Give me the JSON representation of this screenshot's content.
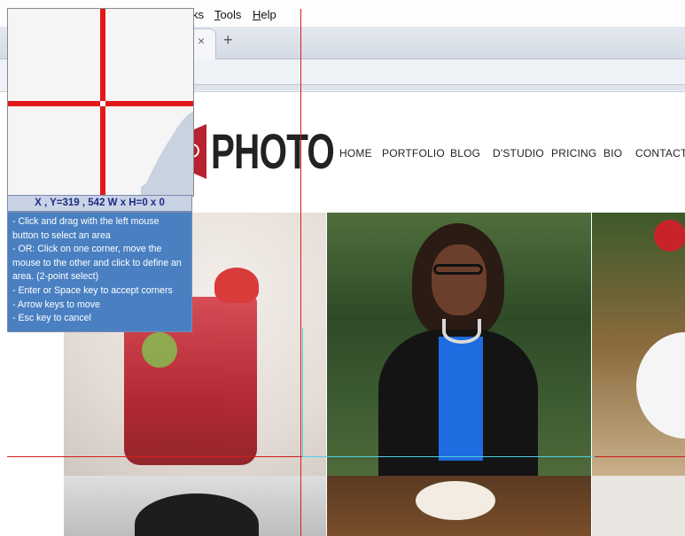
{
  "browser": {
    "menu": [
      {
        "label": "ks"
      },
      {
        "label": "Tools",
        "underline": "T",
        "rest": "ools"
      },
      {
        "label": "Help",
        "underline": "H",
        "rest": "elp"
      }
    ],
    "tab_close": "×",
    "new_tab": "+"
  },
  "site": {
    "logo_text": "PHOTO",
    "logo_color": "#b8212f",
    "nav": [
      "HOME",
      "PORTFOLIO",
      "BLOG",
      "D'STUDIO",
      "PRICING",
      "BIO",
      "CONTACT"
    ]
  },
  "capture_tool": {
    "coords": "X , Y=319 , 542    W x H=0 x 0",
    "help": [
      "- Click and drag with the left mouse button to select an area",
      "- OR: Click on one corner, move the mouse to the other and click to define an area. (2-point select)",
      "- Enter or Space key to accept corners",
      "- Arrow keys to move",
      "- Esc key to cancel"
    ],
    "crosshair_color": "#d21e1e",
    "panel_color": "#4a80c2"
  }
}
